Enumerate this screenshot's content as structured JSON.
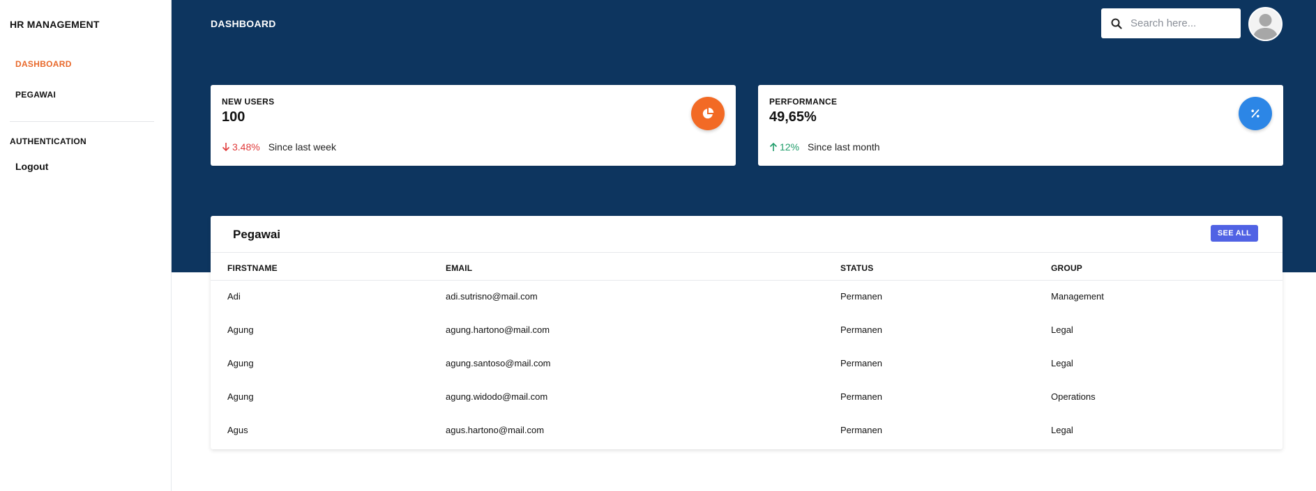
{
  "sidebar": {
    "brand": "HR MANAGEMENT",
    "items": [
      {
        "label": "DASHBOARD",
        "active": true
      },
      {
        "label": "PEGAWAI",
        "active": false
      }
    ],
    "section_heading": "AUTHENTICATION",
    "logout_label": "Logout"
  },
  "header": {
    "title": "DASHBOARD",
    "search_placeholder": "Search here...",
    "search_icon": "search-icon",
    "avatar_icon": "user-avatar-icon"
  },
  "stats": [
    {
      "label": "NEW USERS",
      "value": "100",
      "trend_direction": "down",
      "trend_value": "3.48%",
      "since": "Since last week",
      "icon": "pie-chart-icon",
      "icon_color": "#f26a25"
    },
    {
      "label": "PERFORMANCE",
      "value": "49,65%",
      "trend_direction": "up",
      "trend_value": "12%",
      "since": "Since last month",
      "icon": "percent-icon",
      "icon_color": "#2c86e6"
    }
  ],
  "table": {
    "title": "Pegawai",
    "see_all_label": "SEE ALL",
    "columns": [
      "FIRSTNAME",
      "EMAIL",
      "STATUS",
      "GROUP"
    ],
    "rows": [
      [
        "Adi",
        "adi.sutrisno@mail.com",
        "Permanen",
        "Management"
      ],
      [
        "Agung",
        "agung.hartono@mail.com",
        "Permanen",
        "Legal"
      ],
      [
        "Agung",
        "agung.santoso@mail.com",
        "Permanen",
        "Legal"
      ],
      [
        "Agung",
        "agung.widodo@mail.com",
        "Permanen",
        "Operations"
      ],
      [
        "Agus",
        "agus.hartono@mail.com",
        "Permanen",
        "Legal"
      ]
    ]
  },
  "colors": {
    "banner": "#0d355f",
    "accent": "#e8682a",
    "button": "#5062e4",
    "trend_down": "#e03a3a",
    "trend_up": "#1f9d6a"
  }
}
